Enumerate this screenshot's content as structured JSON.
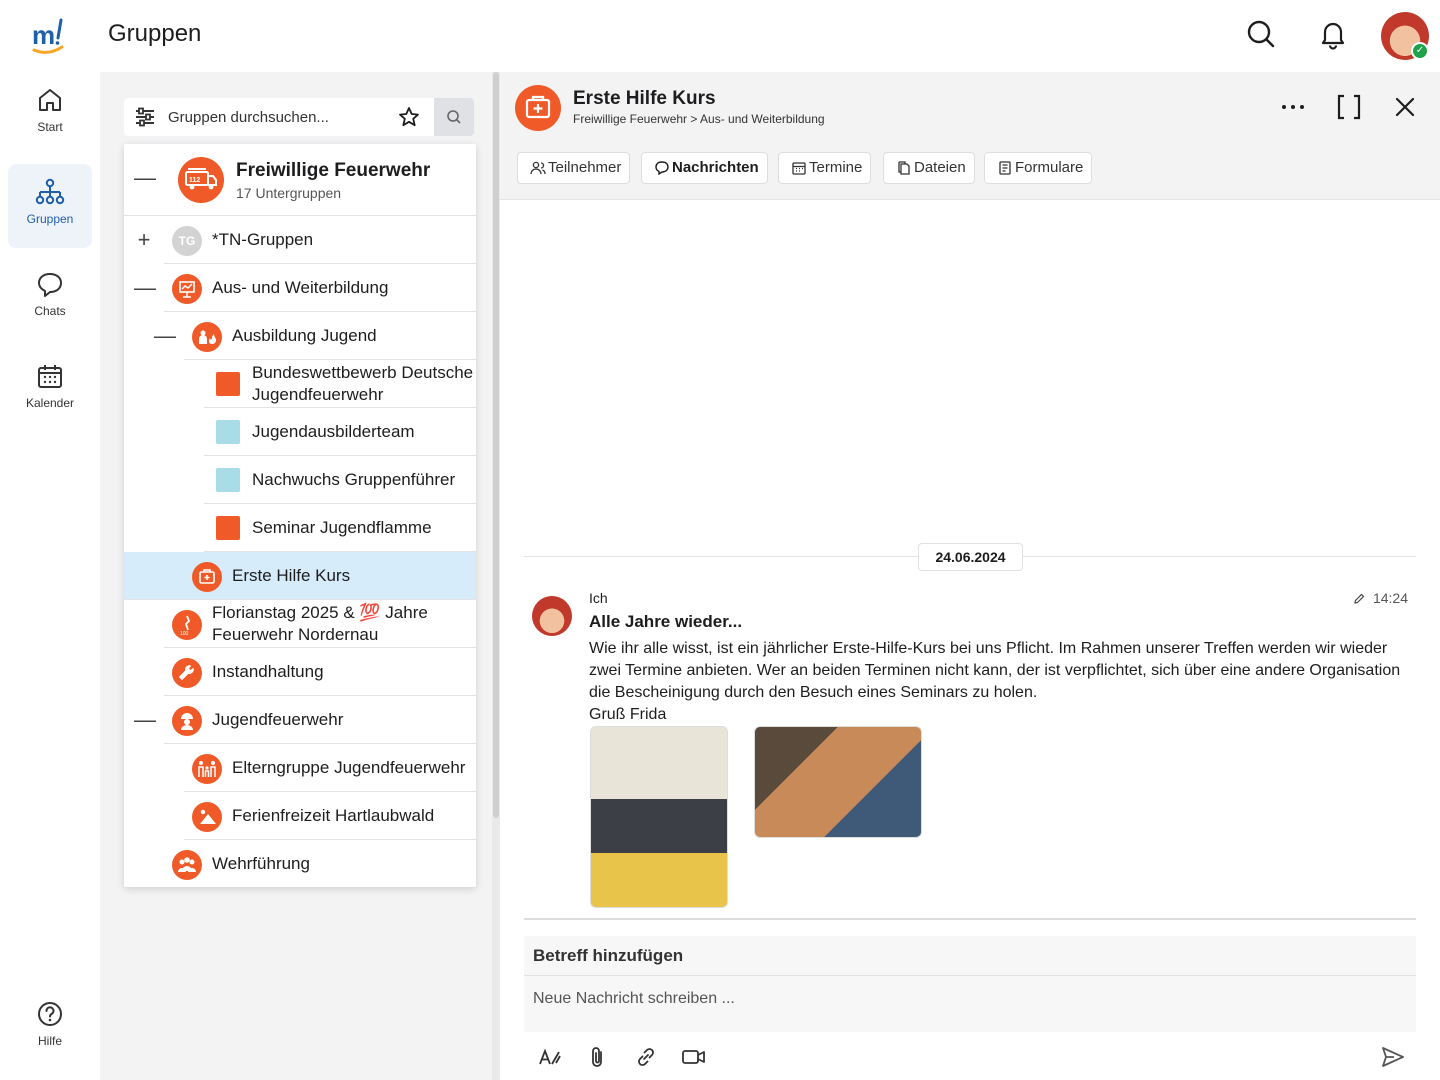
{
  "header": {
    "title": "Gruppen"
  },
  "nav": {
    "items": [
      {
        "label": "Start"
      },
      {
        "label": "Gruppen"
      },
      {
        "label": "Chats"
      },
      {
        "label": "Kalender"
      }
    ],
    "help_label": "Hilfe"
  },
  "groups": {
    "search_placeholder": "Gruppen durchsuchen...",
    "root": {
      "name": "Freiwillige Feuerwehr",
      "subtitle": "17 Untergruppen"
    },
    "items": [
      {
        "name": "*TN-Gruppen",
        "initials": "TG"
      },
      {
        "name": "Aus- und Weiterbildung"
      },
      {
        "name": "Ausbildung Jugend"
      },
      {
        "name": "Bundeswettbewerb Deutsche Jugendfeuerwehr"
      },
      {
        "name": "Jugendausbilderteam"
      },
      {
        "name": "Nachwuchs Gruppenführer"
      },
      {
        "name": "Seminar Jugendflamme"
      },
      {
        "name": "Erste Hilfe Kurs"
      },
      {
        "name": "Florianstag 2025 & 💯 Jahre Feuerwehr Nordernau"
      },
      {
        "name": "Instandhaltung"
      },
      {
        "name": "Jugendfeuerwehr"
      },
      {
        "name": "Elterngruppe Jugendfeuerwehr"
      },
      {
        "name": "Ferienfreizeit Hartlaubwald"
      },
      {
        "name": "Wehrführung"
      }
    ]
  },
  "detail": {
    "title": "Erste Hilfe Kurs",
    "breadcrumb": "Freiwillige Feuerwehr > Aus- und Weiterbildung",
    "tabs": [
      {
        "label": "Teilnehmer"
      },
      {
        "label": "Nachrichten"
      },
      {
        "label": "Termine"
      },
      {
        "label": "Dateien"
      },
      {
        "label": "Formulare"
      }
    ],
    "date_separator": "24.06.2024",
    "message": {
      "author": "Ich",
      "time": "14:24",
      "subject": "Alle Jahre wieder...",
      "body": "Wie ihr alle wisst, ist ein jährlicher Erste-Hilfe-Kurs bei uns Pflicht. Im Rahmen unserer Treffen werden wir wieder zwei Termine anbieten. Wer an beiden Terminen nicht kann, der ist verpflichtet, sich über eine andere Organisation die Bescheinigung durch den Besuch eines Seminars zu holen.",
      "signature": "Gruß Frida"
    },
    "composer": {
      "subject_placeholder": "Betreff hinzufügen",
      "body_placeholder": "Neue Nachricht schreiben ..."
    }
  },
  "colors": {
    "accent": "#f05a28",
    "selected": "#d6ecfb",
    "nav_active": "#1f5fa8",
    "teal": "#a8dce6"
  }
}
